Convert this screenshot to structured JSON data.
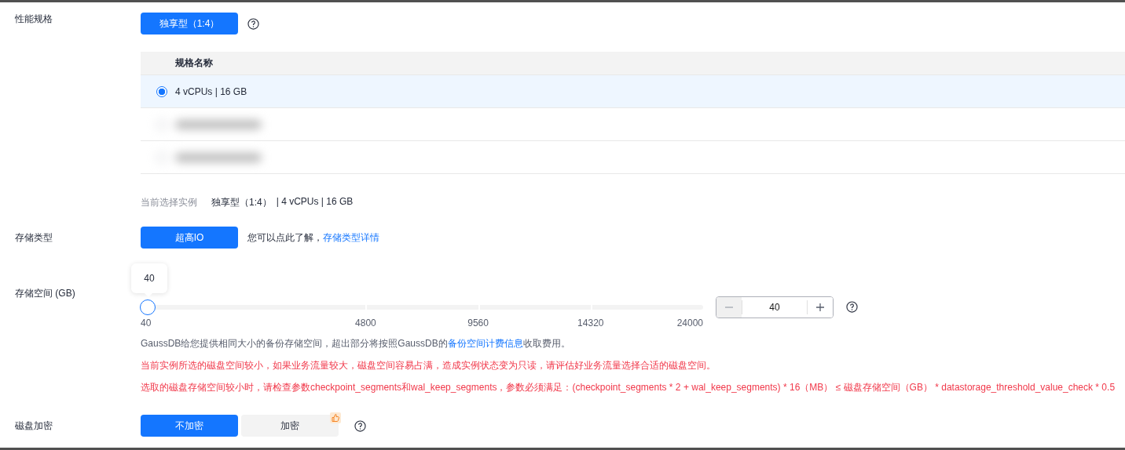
{
  "performance": {
    "label": "性能规格",
    "type_buttons": [
      {
        "label": "独享型（1:4）",
        "selected": true
      }
    ],
    "table": {
      "columns": [
        "规格名称"
      ],
      "rows": [
        {
          "kind": "option",
          "label": "4 vCPUs | 16 GB",
          "selected": true
        },
        {
          "kind": "redacted",
          "selected": false
        },
        {
          "kind": "redacted",
          "selected": false
        }
      ]
    },
    "current": {
      "label": "当前选择实例",
      "value": "独享型（1:4）",
      "detail": "| 4 vCPUs | 16 GB"
    }
  },
  "storage_type": {
    "label": "存储类型",
    "buttons": [
      {
        "label": "超高IO",
        "selected": true
      }
    ],
    "hint": "您可以点此了解，",
    "link": "存储类型详情"
  },
  "storage_space": {
    "label": "存储空间 (GB)",
    "tooltip": "40",
    "level": 0,
    "marks": [
      "40",
      "4800",
      "9560",
      "14320",
      "24000"
    ],
    "stepper": {
      "value": "40",
      "minus_disabled": true,
      "plus_disabled": false
    },
    "notes": [
      {
        "kind": "info",
        "text": "GaussDB给您提供相同大小的备份存储空间，超出部分将按照GaussDB的",
        "link": "备份空间计费信息",
        "after": "收取费用。"
      },
      {
        "kind": "warning",
        "text": "当前实例所选的磁盘空间较小，如果业务流量较大，磁盘空间容易占满，造成实例状态变为只读，请评估好业务流量选择合适的磁盘空间。"
      },
      {
        "kind": "warning",
        "text": "选取的磁盘存储空间较小时，请检查参数checkpoint_segments和wal_keep_segments，参数必须满足：(checkpoint_segments * 2 + wal_keep_segments) * 16（MB） ≤ 磁盘存储空间（GB） * datastorage_threshold_value_check * 0.5"
      }
    ]
  },
  "encryption": {
    "label": "磁盘加密",
    "options": [
      {
        "label": "不加密",
        "selected": true,
        "recommended": false
      },
      {
        "label": "加密",
        "selected": false,
        "recommended": true
      }
    ]
  }
}
